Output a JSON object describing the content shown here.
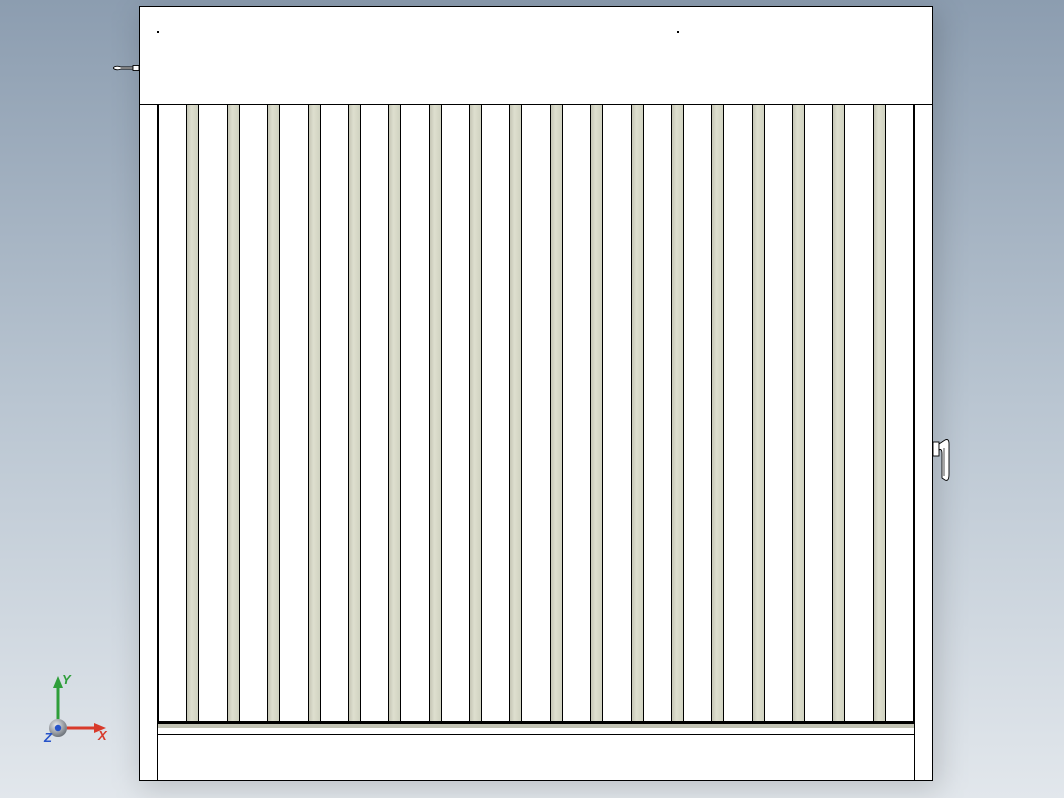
{
  "triad": {
    "axis_x": {
      "label": "X",
      "color": "#d83a2b"
    },
    "axis_y": {
      "label": "Y",
      "color": "#2e9e3a"
    },
    "axis_z": {
      "label": "Z",
      "color": "#2653c9"
    },
    "origin_bulb_color": "#9aa0a6"
  },
  "model": {
    "slat_count": 18,
    "slat_color": "#d0d2c1",
    "face_color": "#ffffff",
    "outline_color": "#000000"
  }
}
